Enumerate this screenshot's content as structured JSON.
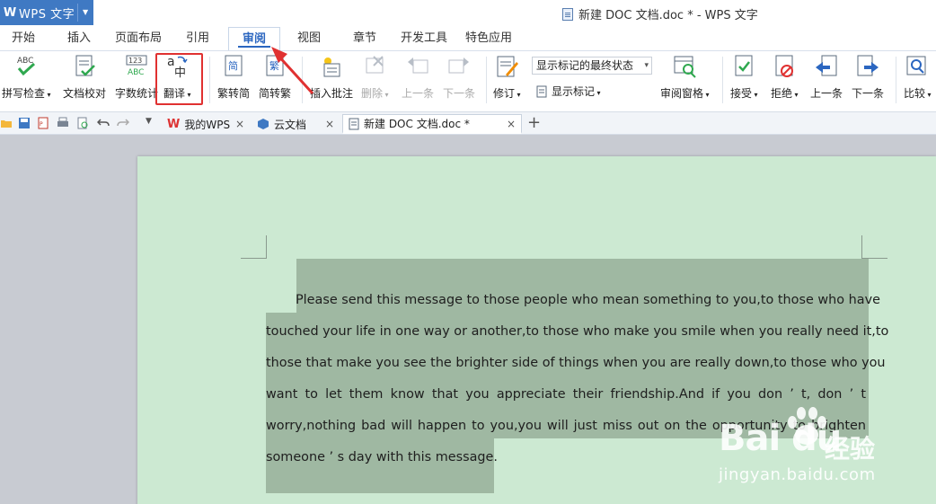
{
  "app": {
    "name": "WPS 文字",
    "logo": "W"
  },
  "window_title": "新建 DOC 文档.doc * - WPS 文字",
  "menu_tabs": [
    {
      "label": "开始"
    },
    {
      "label": "插入"
    },
    {
      "label": "页面布局"
    },
    {
      "label": "引用"
    },
    {
      "label": "审阅",
      "active": true
    },
    {
      "label": "视图"
    },
    {
      "label": "章节"
    },
    {
      "label": "开发工具"
    },
    {
      "label": "特色应用"
    }
  ],
  "ribbon": {
    "spell_check": "拼写检查",
    "doc_proof": "文档校对",
    "word_count": "字数统计",
    "translate": "翻译",
    "trad_to_simp": "繁转简",
    "simp_to_trad": "简转繁",
    "insert_comment": "插入批注",
    "delete": "删除",
    "prev_comment": "上一条",
    "next_comment": "下一条",
    "track_changes": "修订",
    "status_select": "显示标记的最终状态",
    "show_markup": "显示标记",
    "review_pane": "审阅窗格",
    "accept": "接受",
    "reject": "拒绝",
    "prev_change": "上一条",
    "next_change": "下一条",
    "compare": "比较",
    "icon_abc": "ABC",
    "icon_123": "123",
    "icon_simp": "简",
    "icon_trad": "繁",
    "icon_a": "a",
    "icon_zhong": "中"
  },
  "doc_tabs": [
    {
      "label": "我的WPS"
    },
    {
      "label": "云文档"
    },
    {
      "label": "新建 DOC 文档.doc *",
      "active": true
    }
  ],
  "document": {
    "lines": [
      "Please send this message to those people who mean something to you,to those who have",
      "touched your life in one way or another,to those who make you smile when you really need it,to",
      "those that make you see the brighter side of things when you are really down,to those who you",
      "want to let them know that you appreciate their friendship.And if you don ’ t, don ’ t",
      "worry,nothing bad will happen to you,you will just miss out on the opportunity to brighten",
      "someone ’ s day with this message."
    ]
  },
  "watermark": {
    "logo": "Bai du",
    "cn": "经验",
    "url": "jingyan.baidu.com"
  },
  "colors": {
    "accent": "#3f79c3",
    "page_bg": "#cce9d2",
    "selection": "#9fb8a2",
    "highlight": "#e03131"
  }
}
